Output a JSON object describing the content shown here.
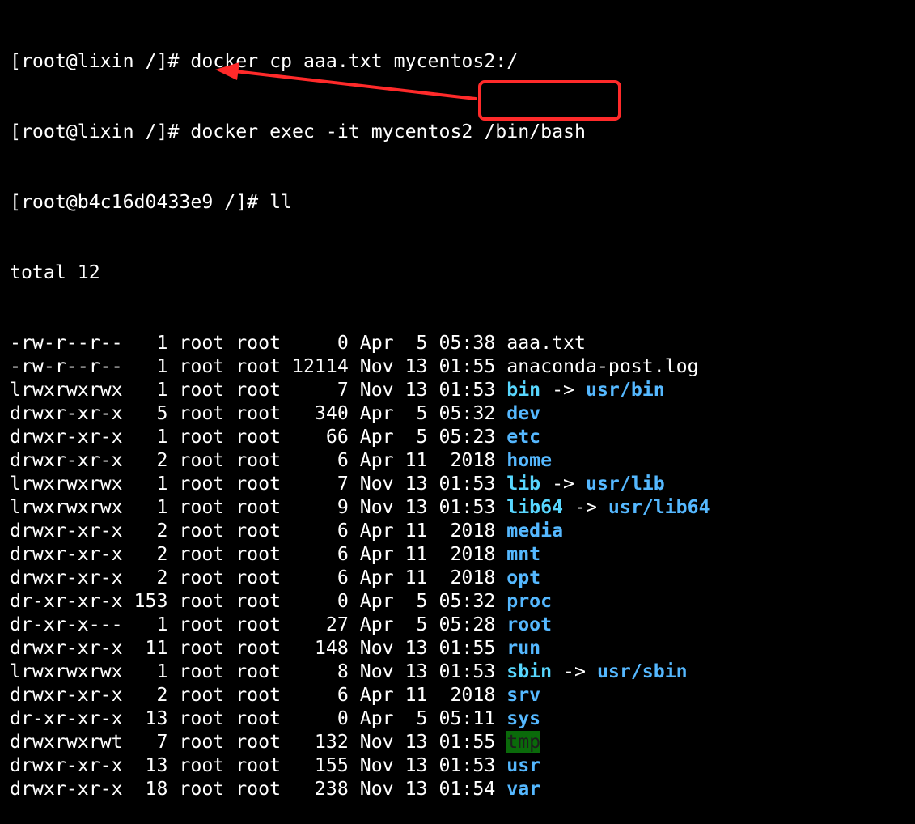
{
  "colors": {
    "background": "#000000",
    "text": "#ffffff",
    "directory": "#55b8ff",
    "symlink": "#58d7ff",
    "annotation": "#ff2a2a",
    "tmp_highlight": "#0a6a0a"
  },
  "terminal": {
    "commands": [
      "[root@lixin /]# docker cp aaa.txt mycentos2:/",
      "[root@lixin /]# docker exec -it mycentos2 /bin/bash",
      "[root@b4c16d0433e9 /]# ll"
    ],
    "total": "total 12",
    "listing": [
      {
        "prefix": "-rw-r--r--   1 root root     0 Apr  5 05:38 ",
        "name": "aaa.txt",
        "name_style": "plain",
        "arrow": "",
        "target": ""
      },
      {
        "prefix": "-rw-r--r--   1 root root 12114 Nov 13 01:55 ",
        "name": "anaconda-post.log",
        "name_style": "plain",
        "arrow": "",
        "target": ""
      },
      {
        "prefix": "lrwxrwxrwx   1 root root     7 Nov 13 01:53 ",
        "name": "bin",
        "name_style": "cyan",
        "arrow": " -> ",
        "target": "usr/bin"
      },
      {
        "prefix": "drwxr-xr-x   5 root root   340 Apr  5 05:32 ",
        "name": "dev",
        "name_style": "blue",
        "arrow": "",
        "target": ""
      },
      {
        "prefix": "drwxr-xr-x   1 root root    66 Apr  5 05:23 ",
        "name": "etc",
        "name_style": "blue",
        "arrow": "",
        "target": ""
      },
      {
        "prefix": "drwxr-xr-x   2 root root     6 Apr 11  2018 ",
        "name": "home",
        "name_style": "blue",
        "arrow": "",
        "target": ""
      },
      {
        "prefix": "lrwxrwxrwx   1 root root     7 Nov 13 01:53 ",
        "name": "lib",
        "name_style": "cyan",
        "arrow": " -> ",
        "target": "usr/lib"
      },
      {
        "prefix": "lrwxrwxrwx   1 root root     9 Nov 13 01:53 ",
        "name": "lib64",
        "name_style": "cyan",
        "arrow": " -> ",
        "target": "usr/lib64"
      },
      {
        "prefix": "drwxr-xr-x   2 root root     6 Apr 11  2018 ",
        "name": "media",
        "name_style": "blue",
        "arrow": "",
        "target": ""
      },
      {
        "prefix": "drwxr-xr-x   2 root root     6 Apr 11  2018 ",
        "name": "mnt",
        "name_style": "blue",
        "arrow": "",
        "target": ""
      },
      {
        "prefix": "drwxr-xr-x   2 root root     6 Apr 11  2018 ",
        "name": "opt",
        "name_style": "blue",
        "arrow": "",
        "target": ""
      },
      {
        "prefix": "dr-xr-xr-x 153 root root     0 Apr  5 05:32 ",
        "name": "proc",
        "name_style": "blue",
        "arrow": "",
        "target": ""
      },
      {
        "prefix": "dr-xr-x---   1 root root    27 Apr  5 05:28 ",
        "name": "root",
        "name_style": "blue",
        "arrow": "",
        "target": ""
      },
      {
        "prefix": "drwxr-xr-x  11 root root   148 Nov 13 01:55 ",
        "name": "run",
        "name_style": "blue",
        "arrow": "",
        "target": ""
      },
      {
        "prefix": "lrwxrwxrwx   1 root root     8 Nov 13 01:53 ",
        "name": "sbin",
        "name_style": "cyan",
        "arrow": " -> ",
        "target": "usr/sbin"
      },
      {
        "prefix": "drwxr-xr-x   2 root root     6 Apr 11  2018 ",
        "name": "srv",
        "name_style": "blue",
        "arrow": "",
        "target": ""
      },
      {
        "prefix": "dr-xr-xr-x  13 root root     0 Apr  5 05:11 ",
        "name": "sys",
        "name_style": "blue",
        "arrow": "",
        "target": ""
      },
      {
        "prefix": "drwxrwxrwt   7 root root   132 Nov 13 01:55 ",
        "name": "tmp",
        "name_style": "tmp",
        "arrow": "",
        "target": ""
      },
      {
        "prefix": "drwxr-xr-x  13 root root   155 Nov 13 01:53 ",
        "name": "usr",
        "name_style": "blue",
        "arrow": "",
        "target": ""
      },
      {
        "prefix": "drwxr-xr-x  18 root root   238 Nov 13 01:54 ",
        "name": "var",
        "name_style": "blue",
        "arrow": "",
        "target": ""
      }
    ]
  }
}
